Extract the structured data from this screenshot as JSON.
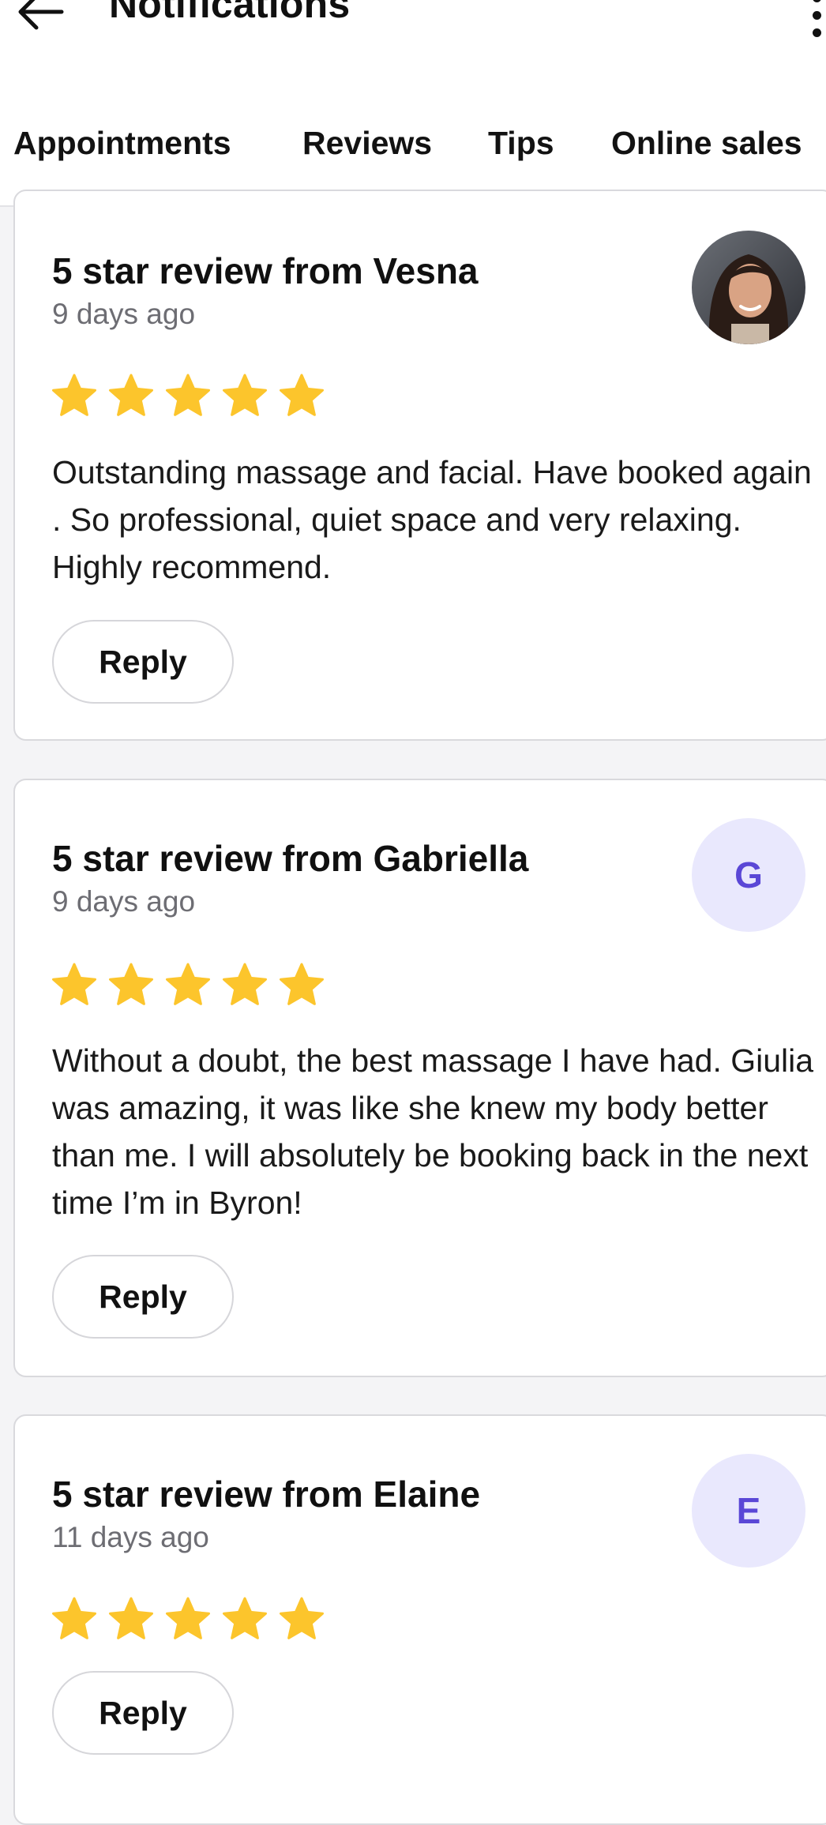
{
  "header": {
    "title": "Notifications"
  },
  "tabs": [
    {
      "label": "Appointments",
      "active": false
    },
    {
      "label": "Reviews",
      "active": true
    },
    {
      "label": "Tips",
      "active": false
    },
    {
      "label": "Online sales",
      "active": false
    }
  ],
  "colors": {
    "star": "#fcc52c",
    "avatar_bg": "#e9e8fd",
    "avatar_text": "#5a47d6"
  },
  "reviews": [
    {
      "title": "5 star review from Vesna",
      "time": "9 days ago",
      "rating": 5,
      "text": "Outstanding massage and facial. Have booked again . So professional, quiet space and very relaxing. Highly recommend.",
      "reply_label": "Reply",
      "avatar_type": "photo"
    },
    {
      "title": "5 star review from Gabriella",
      "time": "9 days ago",
      "rating": 5,
      "text": "Without a doubt, the best massage I have had. Giulia was amazing, it was like she knew my body better than me. I will absolutely be booking back in the next time I’m in Byron!",
      "reply_label": "Reply",
      "avatar_initial": "G"
    },
    {
      "title": "5 star review from Elaine",
      "time": "11 days ago",
      "rating": 5,
      "text": "",
      "reply_label": "Reply",
      "avatar_initial": "E"
    }
  ]
}
